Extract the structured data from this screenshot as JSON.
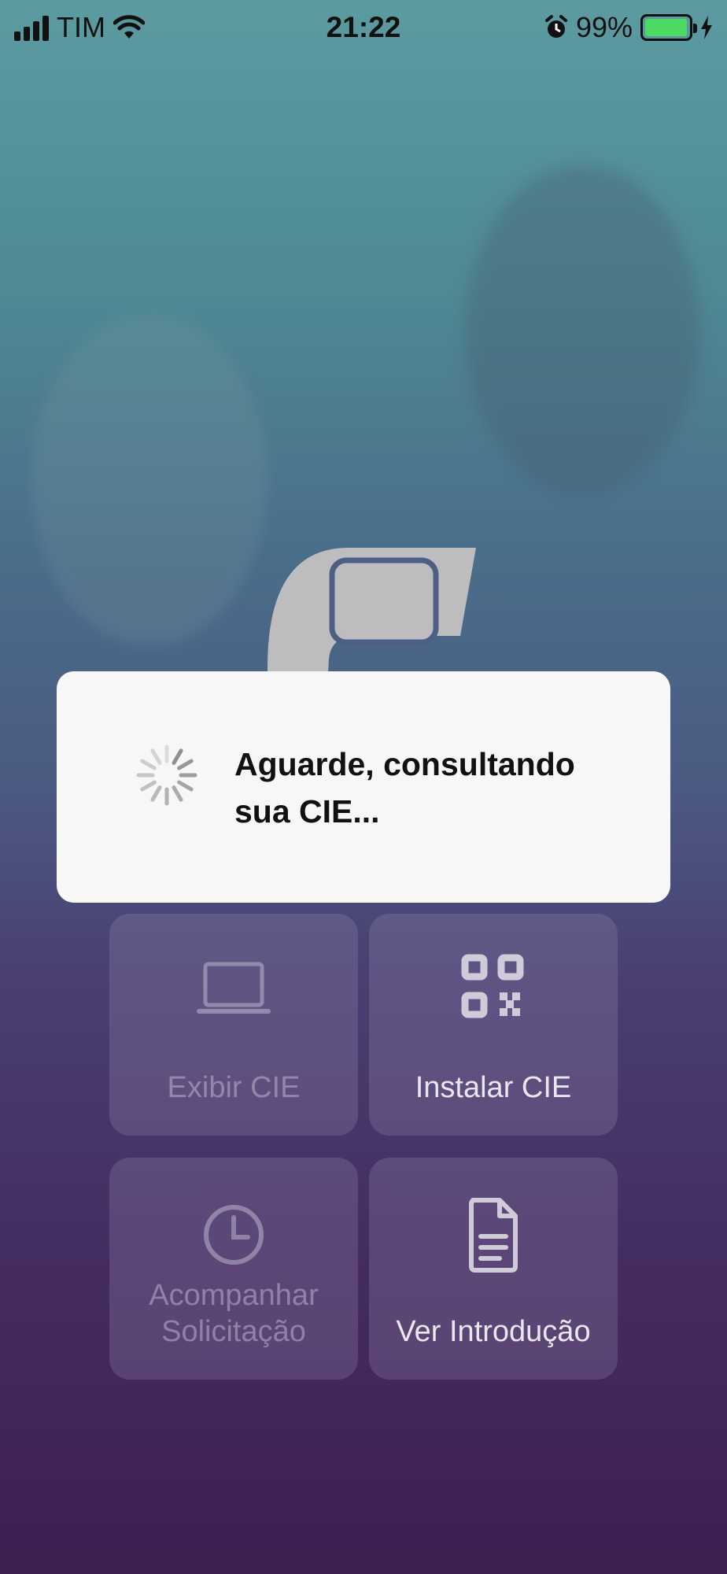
{
  "status_bar": {
    "carrier": "TIM",
    "time": "21:22",
    "battery_percent": "99%",
    "battery_level": 0.99,
    "icons": [
      "signal-bars-icon",
      "wifi-icon",
      "alarm-icon",
      "battery-icon",
      "charging-bolt-icon"
    ]
  },
  "logo": {
    "icon": "cie-logo-icon"
  },
  "dialog": {
    "message_line1": "Aguarde, consultando",
    "message_line2": "sua CIE...",
    "icon": "loading-spinner-icon"
  },
  "menu": {
    "exibir_cie": {
      "label": "Exibir CIE",
      "icon": "laptop-icon",
      "enabled": false
    },
    "instalar_cie": {
      "label": "Instalar CIE",
      "icon": "qr-code-icon",
      "enabled": true
    },
    "acompanhar": {
      "label_line1": "Acompanhar",
      "label_line2": "Solicitação",
      "icon": "clock-icon",
      "enabled": false
    },
    "ver_intro": {
      "label": "Ver Introdução",
      "icon": "document-icon",
      "enabled": true
    }
  },
  "colors": {
    "gradient_top": "#5b9ba0",
    "gradient_bottom": "#3d1f52",
    "battery_green": "#4cd964",
    "dialog_bg": "#f7f7f7"
  }
}
